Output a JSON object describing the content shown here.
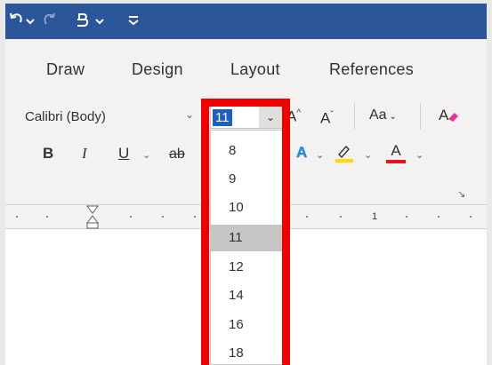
{
  "quick_access": {
    "undo_icon": "undo-icon",
    "redo_icon": "redo-icon",
    "format_painter_icon": "touch-mode-icon",
    "customize_icon": "customize-qat-icon"
  },
  "tabs": [
    {
      "label": "Draw"
    },
    {
      "label": "Design"
    },
    {
      "label": "Layout"
    },
    {
      "label": "References"
    }
  ],
  "font": {
    "name": "Calibri (Body)",
    "size": "11"
  },
  "font_size_options": [
    "8",
    "9",
    "10",
    "11",
    "12",
    "14",
    "16",
    "18"
  ],
  "selected_size": "11",
  "format_buttons": {
    "bold": "B",
    "italic": "I",
    "underline": "U",
    "strikethrough": "ab",
    "grow_font": "A",
    "shrink_font": "A",
    "change_case": "Aa",
    "text_effects": "A",
    "font_color": "A"
  },
  "ruler": {
    "number": "1"
  },
  "colors": {
    "title_bar": "#2b579a",
    "ribbon": "#f3f2f1",
    "highlight": "#ee0000",
    "selected_value": "#1e5fc7",
    "font_color_bar": "#e81123",
    "highlight_color_bar": "#ffd800"
  }
}
